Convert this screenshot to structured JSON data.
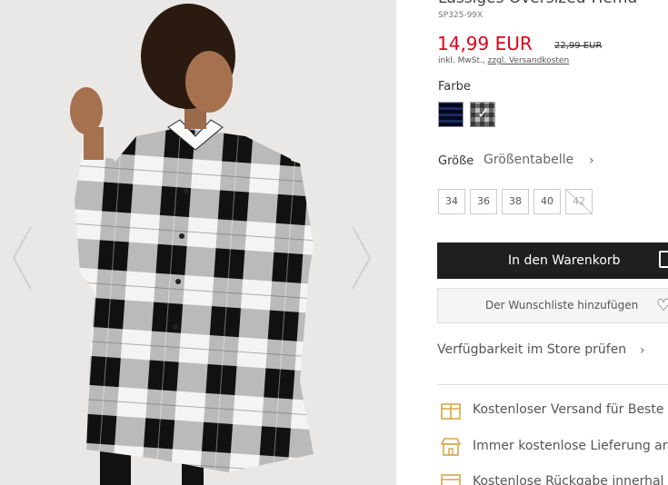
{
  "gallery": {
    "prev_icon": "chevron-left-icon",
    "next_icon": "chevron-right-icon"
  },
  "product": {
    "title": "Lässiges Oversized-Hemd",
    "sku": "SP325-99X",
    "price": "14,99 EUR",
    "old_price": "22,99 EUR",
    "tax_prefix": "inkl. MwSt., ",
    "shipping_link": "zzgl. Versandkosten",
    "price_color": "#e2001a"
  },
  "color": {
    "label": "Farbe",
    "swatches": [
      "navy-check",
      "grey-check"
    ]
  },
  "size": {
    "label": "Größe",
    "chart_link": "Größentabelle",
    "options": [
      "34",
      "36",
      "38",
      "40",
      "42"
    ]
  },
  "actions": {
    "cart_label": "In den Warenkorb",
    "wishlist_label": "Der Wunschliste hinzufügen",
    "availability_label": "Verfügbarkeit im Store prüfen"
  },
  "features": [
    {
      "icon": "box-icon",
      "text": "Kostenloser Versand für Beste"
    },
    {
      "icon": "store-icon",
      "text": "Immer kostenlose Lieferung ar"
    },
    {
      "icon": "calendar-icon",
      "text": "Kostenlose Rückgabe innerhal"
    }
  ]
}
